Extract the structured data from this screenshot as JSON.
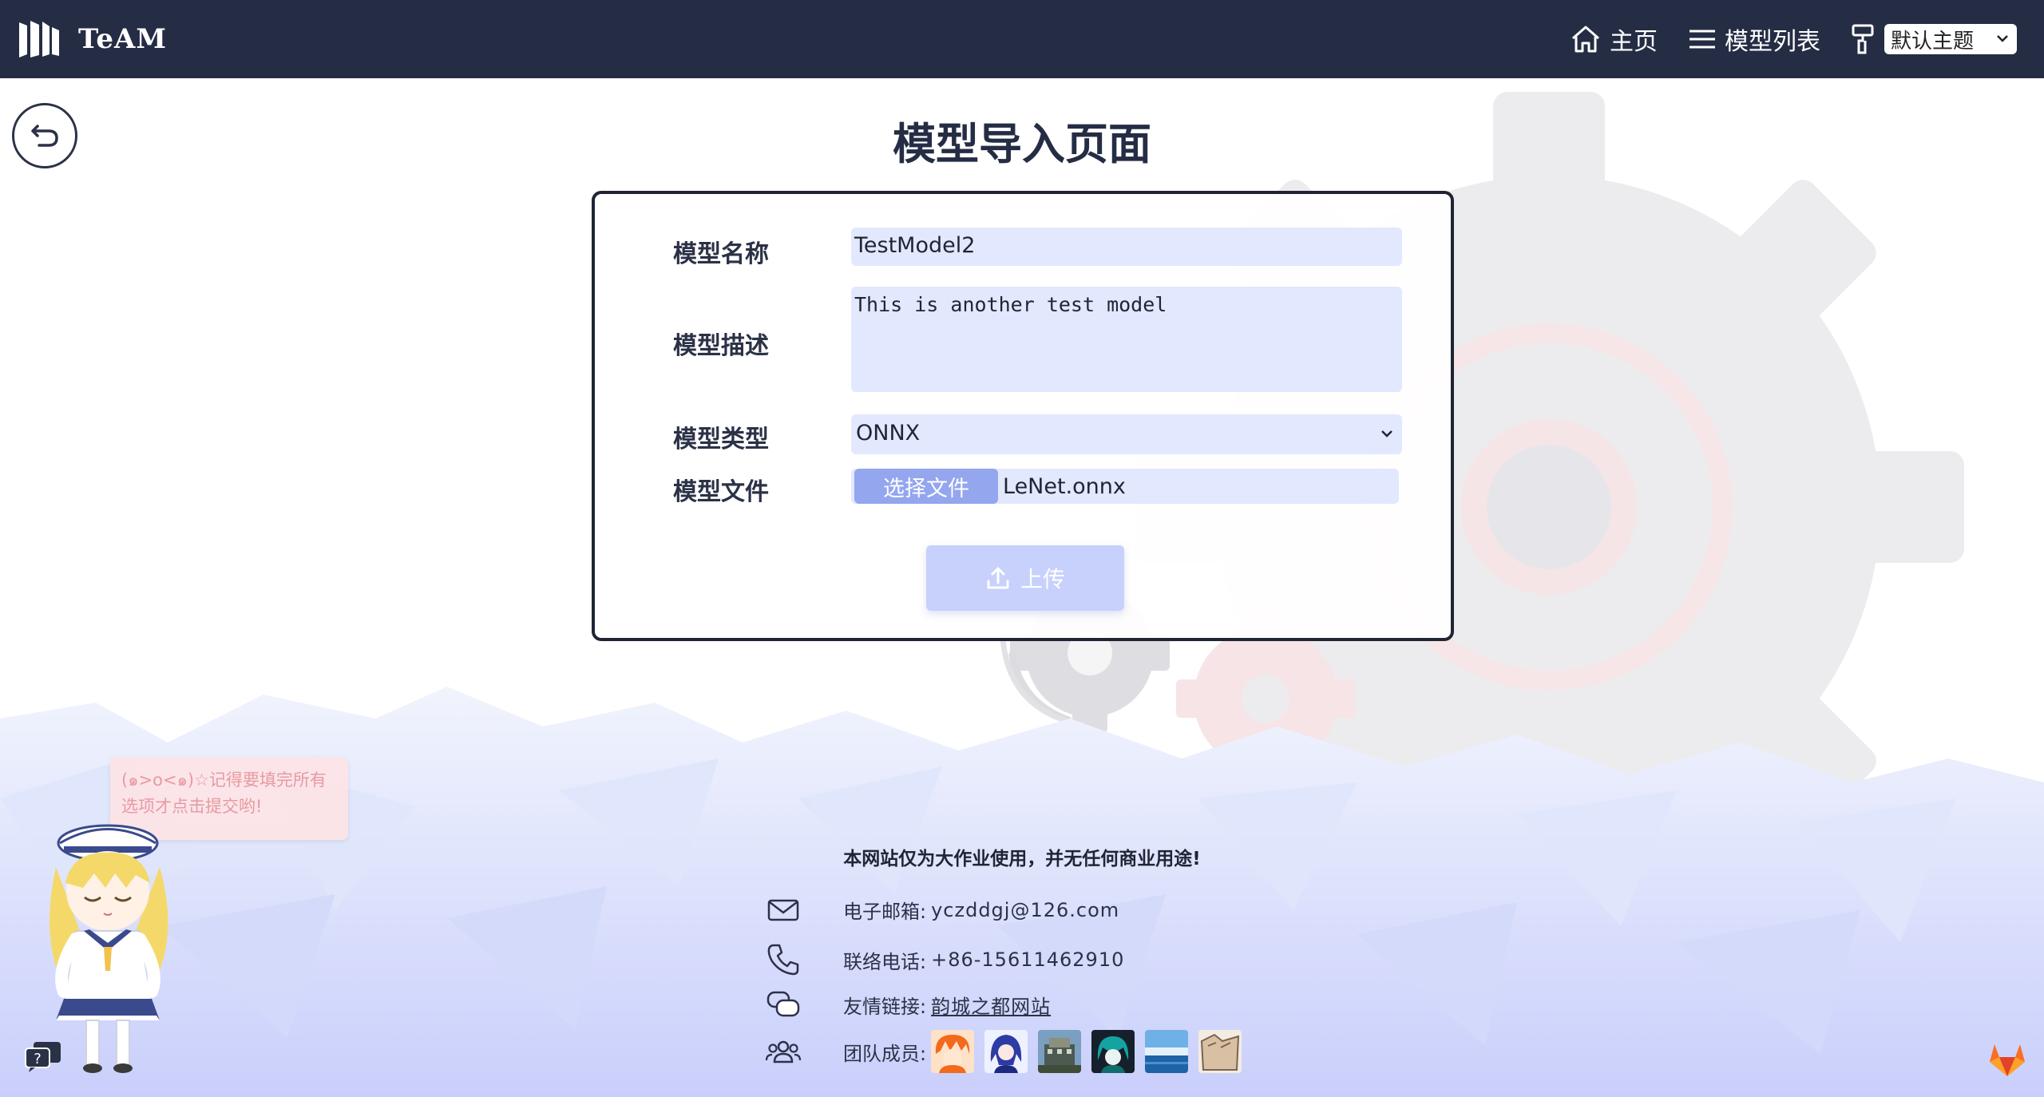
{
  "navbar": {
    "brand_name": "TeAM",
    "links": [
      {
        "label": "主页",
        "icon": "home-icon"
      },
      {
        "label": "模型列表",
        "icon": "list-icon"
      }
    ],
    "theme_icon": "paint-roller-icon",
    "theme_select_value": "默认主题"
  },
  "page": {
    "title": "模型导入页面",
    "back_icon": "undo-arrow-icon"
  },
  "form": {
    "name_label": "模型名称",
    "name_value": "TestModel2",
    "desc_label": "模型描述",
    "desc_value": "This is another test model",
    "type_label": "模型类型",
    "type_value": "ONNX",
    "file_label": "模型文件",
    "file_button": "选择文件",
    "file_name": "LeNet.onnx",
    "upload_button": "上传",
    "upload_icon": "upload-icon"
  },
  "footer": {
    "note": "本网站仅为大作业使用，并无任何商业用途!",
    "email_label": "电子邮箱:",
    "email_value": "yczddgj@126.com",
    "phone_label": "联络电话:",
    "phone_value": "+86-15611462910",
    "link_label": "友情链接:",
    "link_value": "韵城之都网站",
    "members_label": "团队成员:",
    "member_avatars": [
      "avatar-orange-hair",
      "avatar-blue-hair",
      "avatar-building",
      "avatar-dark-teal",
      "avatar-sky",
      "avatar-paper"
    ]
  },
  "mascot": {
    "speech": "(๑>o<๑)☆记得要填完所有选项才点击提交哟!"
  },
  "colors": {
    "navbar_bg": "#252d45",
    "field_bg": "#e2e8fd",
    "file_button_bg": "#93a6ee",
    "upload_button_bg": "#c7d1fb",
    "speech_bg": "#fde4e6"
  }
}
